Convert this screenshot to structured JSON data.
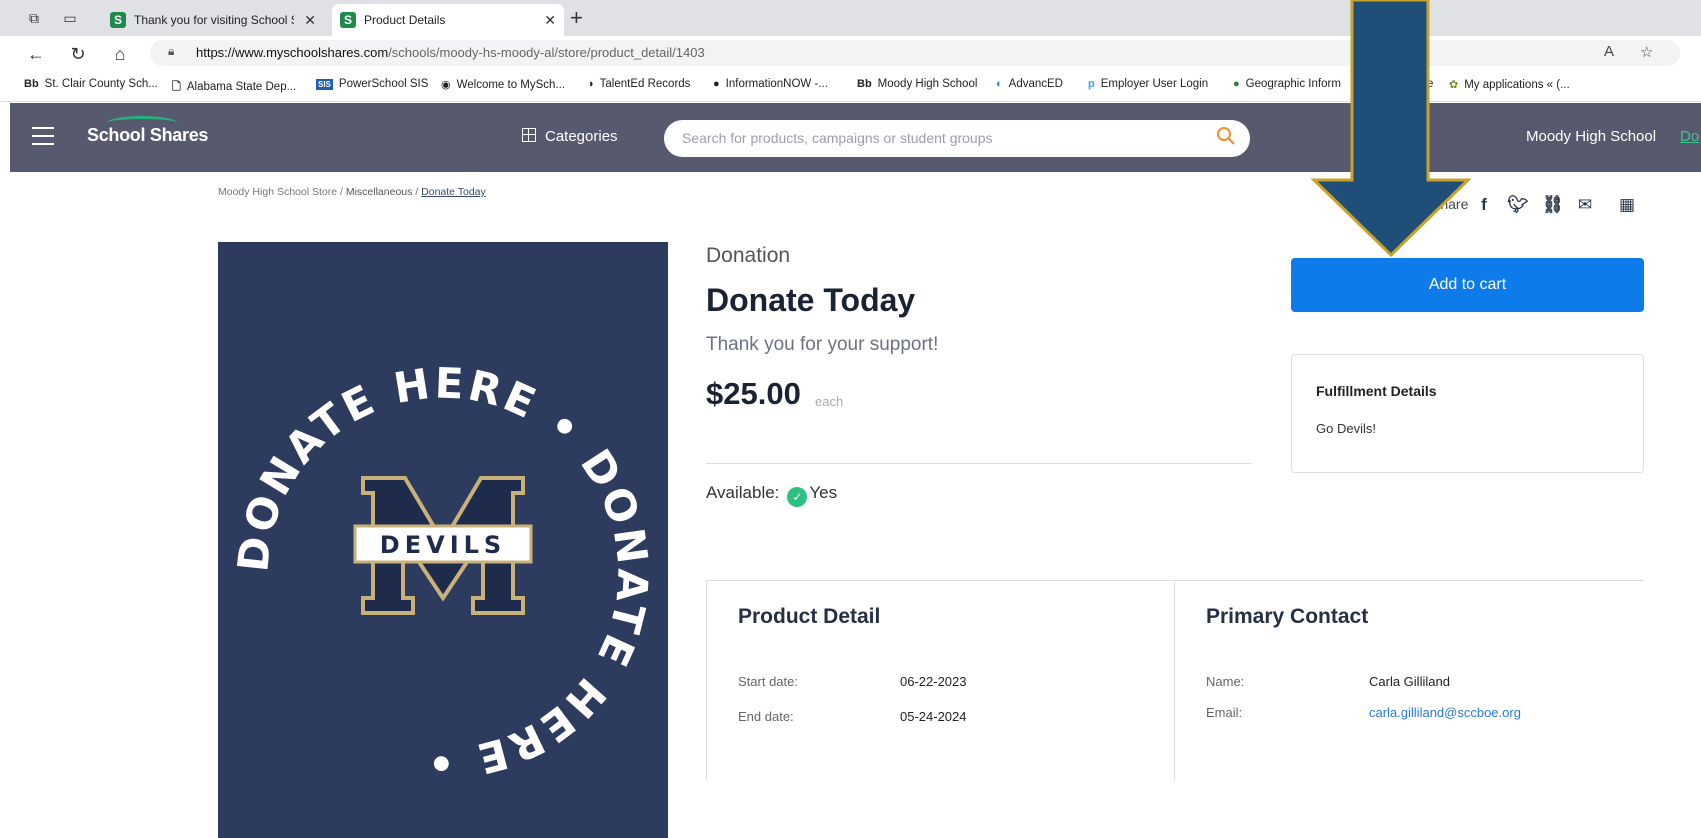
{
  "browser": {
    "tabs": [
      {
        "title": "Thank you for visiting School Sha",
        "favicon": "S"
      },
      {
        "title": "Product Details",
        "favicon": "S"
      }
    ],
    "url_host": "https://www.myschoolshares.com",
    "url_path": "/schools/moody-hs-moody-al/store/product_detail/1403",
    "bookmarks": [
      {
        "icon": "Bb",
        "label": "St. Clair County Sch..."
      },
      {
        "icon": "page",
        "label": "Alabama State Dep..."
      },
      {
        "icon": "SIS",
        "label": "PowerSchool SIS"
      },
      {
        "icon": "globe",
        "label": "Welcome to MySch..."
      },
      {
        "icon": "ted",
        "label": "TalentEd Records"
      },
      {
        "icon": "dot",
        "label": "InformationNOW -..."
      },
      {
        "icon": "Bb",
        "label": "Moody High School"
      },
      {
        "icon": "advanced",
        "label": "AdvancED"
      },
      {
        "icon": "p",
        "label": "Employer User Login"
      },
      {
        "icon": "geo",
        "label": "Geographic Inform"
      },
      {
        "icon": "e",
        "label": "e"
      },
      {
        "icon": "apps",
        "label": "My applications « (..."
      }
    ]
  },
  "header": {
    "logo": "School Shares",
    "categories": "Categories",
    "search_placeholder": "Search for products, campaigns or student groups",
    "school": "Moody High School",
    "donate_link": "Do"
  },
  "breadcrumb": {
    "store": "Moody High School Store",
    "sep": " / ",
    "category": "Miscellaneous",
    "current": "Donate Today"
  },
  "product": {
    "category": "Donation",
    "title": "Donate Today",
    "subtitle": "Thank you for your support!",
    "price": "$25.00",
    "price_unit": "each",
    "available_label": "Available:",
    "available_value": "Yes",
    "image_ring_text": "DONATE HERE • DONATE HERE •",
    "image_badge": "DEVILS"
  },
  "share": {
    "label": "Share"
  },
  "cart": {
    "add_label": "Add to cart"
  },
  "fulfillment": {
    "title": "Fulfillment Details",
    "text": "Go Devils!"
  },
  "detail": {
    "title": "Product Detail",
    "start_label": "Start date:",
    "start_value": "06-22-2023",
    "end_label": "End date:",
    "end_value": "05-24-2024"
  },
  "contact": {
    "title": "Primary Contact",
    "name_label": "Name:",
    "name_value": "Carla Gilliland",
    "email_label": "Email:",
    "email_value": "carla.gilliland@sccboe.org"
  },
  "colors": {
    "accent": "#0d7bea",
    "header": "#575a6e",
    "navy": "#2c3b5e",
    "arrow": "#1f4e79",
    "arrow_border": "#c9a227"
  }
}
